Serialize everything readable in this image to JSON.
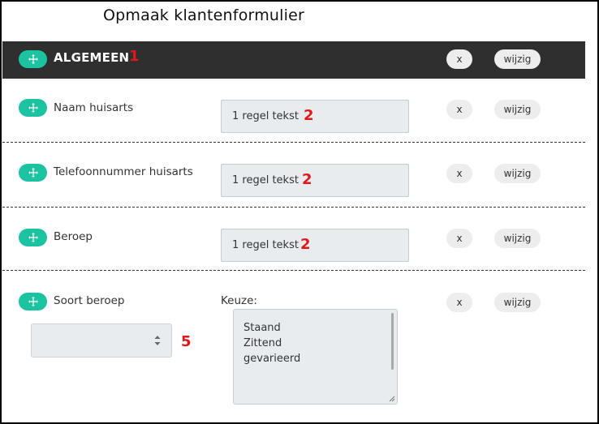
{
  "page": {
    "title": "Opmaak klantenformulier"
  },
  "section": {
    "title": "ALGEMEEN",
    "marker": "1",
    "x_label": "x",
    "edit_label": "wijzig"
  },
  "fields": [
    {
      "label": "Naam huisarts",
      "value": "1 regel tekst",
      "marker": "2",
      "x_label": "x",
      "edit_label": "wijzig"
    },
    {
      "label": "Telefoonnummer huisarts",
      "value": "1 regel tekst",
      "marker": "2",
      "x_label": "x",
      "edit_label": "wijzig"
    },
    {
      "label": "Beroep",
      "value": "1 regel tekst",
      "marker": "2",
      "x_label": "x",
      "edit_label": "wijzig"
    }
  ],
  "choice_field": {
    "label": "Soort beroep",
    "keuze_label": "Keuze:",
    "options": [
      "Staand",
      "Zittend",
      "gevarieerd"
    ],
    "select_marker": "5",
    "selected_value": "",
    "x_label": "x",
    "edit_label": "wijzig"
  },
  "colors": {
    "accent": "#1cc3a1",
    "header_bg": "#2f2f2f",
    "marker": "#e01818"
  },
  "icons": {
    "move": "move-arrows-icon",
    "select": "updown-arrows-icon"
  }
}
